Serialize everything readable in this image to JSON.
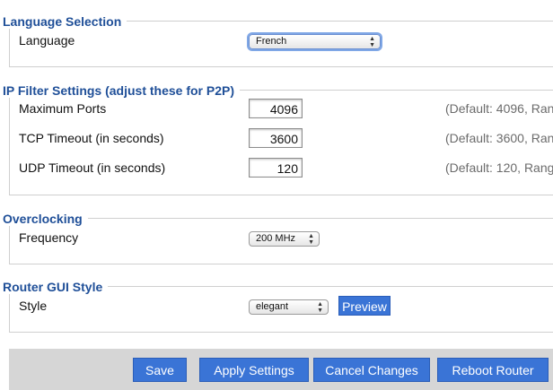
{
  "language_section": {
    "title": "Language Selection",
    "language_label": "Language",
    "language_value": "French"
  },
  "ip_filter_section": {
    "title": "IP Filter Settings (adjust these for P2P)",
    "rows": [
      {
        "label": "Maximum Ports",
        "value": "4096",
        "hint": "(Default: 4096, Ran"
      },
      {
        "label": "TCP Timeout (in seconds)",
        "value": "3600",
        "hint": "(Default: 3600, Ran"
      },
      {
        "label": "UDP Timeout (in seconds)",
        "value": "120",
        "hint": "(Default: 120, Rang"
      }
    ]
  },
  "overclocking_section": {
    "title": "Overclocking",
    "frequency_label": "Frequency",
    "frequency_value": "200 MHz"
  },
  "gui_style_section": {
    "title": "Router GUI Style",
    "style_label": "Style",
    "style_value": "elegant",
    "preview_label": "Preview"
  },
  "footer": {
    "save_label": "Save",
    "apply_label": "Apply Settings",
    "cancel_label": "Cancel Changes",
    "reboot_label": "Reboot Router"
  },
  "colors": {
    "section_title": "#1f4f98",
    "button_blue": "#3a74d6",
    "footer_bg": "#d6d6d6",
    "hint_gray": "#6b6b6b"
  }
}
